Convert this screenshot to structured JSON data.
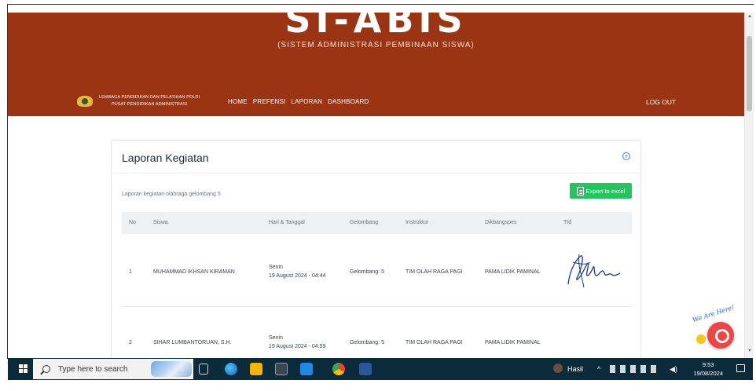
{
  "header": {
    "app_title": "SI-ABIS",
    "app_subtitle": "(SISTEM ADMINISTRASI PEMBINAAN SISWA)",
    "brand_line1": "LEMBAGA PENDIDIKAN DAN PELATIHAN POLRI",
    "brand_line2": "PUSAT PENDIDIKAN ADMINISTRASI",
    "nav": [
      "HOME",
      "PREFENSI",
      "LAPORAN",
      "DASHBOARD"
    ],
    "logout": "LOG OUT",
    "color": "#9a3412"
  },
  "card": {
    "title": "Laporan Kegiatan",
    "description": "Laporan kegiatan olahraga gelombang 5",
    "export_label": "Export to excel",
    "columns": [
      "No",
      "Siswa",
      "Hari & Tanggal",
      "Gelombang",
      "Instruktur",
      "Dikbangspes",
      "Ttd"
    ],
    "rows": [
      {
        "no": "1",
        "siswa": "MUHAMMAD IKHSAN KIRAMAN",
        "hari": "Senin",
        "tanggal": "19 August 2024 - 04:44",
        "gelombang": "Gelombang: 5",
        "instruktur": "TIM OLAH RAGA PAGI",
        "dikbangspes": "PAMA LIDIK PAMINAL"
      },
      {
        "no": "2",
        "siswa": "SIHAR LUMBANTORUAN, S.H.",
        "hari": "Senin",
        "tanggal": "19 August 2024 - 04:59",
        "gelombang": "Gelombang: 5",
        "instruktur": "TIM OLAH RAGA PAGI",
        "dikbangspes": "PAMA LIDIK PAMINAL"
      }
    ]
  },
  "widget": {
    "label": "We Are Here!"
  },
  "taskbar": {
    "search_placeholder": "Type here to search",
    "tray_label": "Hasil",
    "time": "9:53",
    "date": "19/08/2024",
    "color": "#0b2a3a"
  }
}
